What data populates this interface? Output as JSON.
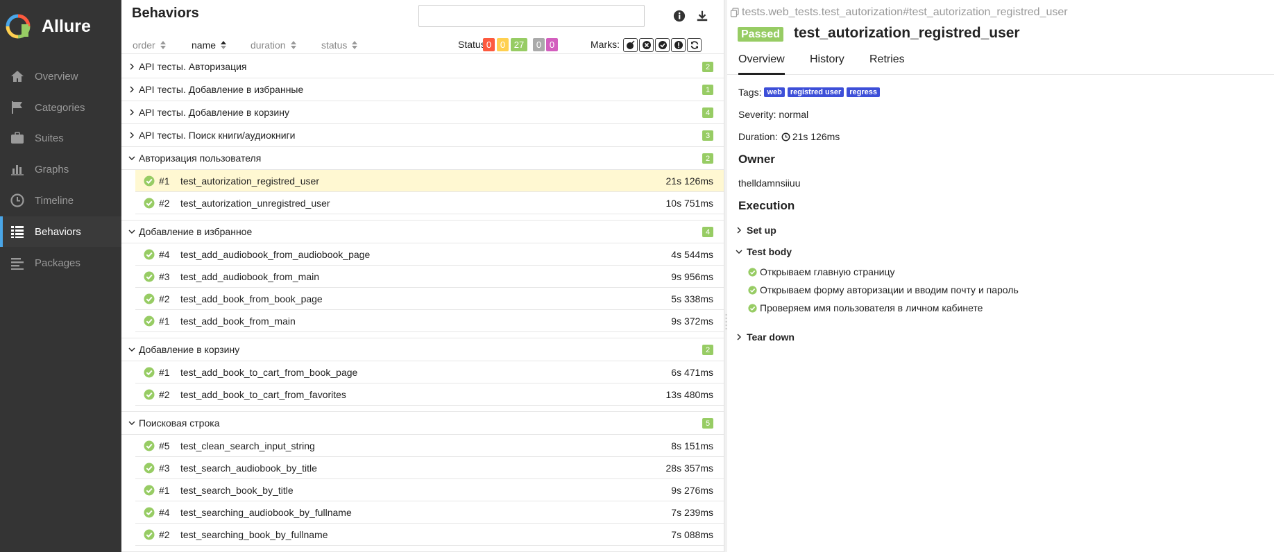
{
  "sidebar": {
    "brand": "Allure",
    "items": [
      {
        "label": "Overview",
        "icon": "home-icon"
      },
      {
        "label": "Categories",
        "icon": "flag-icon"
      },
      {
        "label": "Suites",
        "icon": "briefcase-icon"
      },
      {
        "label": "Graphs",
        "icon": "bar-chart-icon"
      },
      {
        "label": "Timeline",
        "icon": "clock-icon"
      },
      {
        "label": "Behaviors",
        "icon": "list-icon",
        "active": true
      },
      {
        "label": "Packages",
        "icon": "align-left-icon"
      }
    ]
  },
  "tree": {
    "title": "Behaviors",
    "search": {
      "value": "",
      "placeholder": ""
    },
    "sort": {
      "order": "order",
      "name": "name",
      "duration": "duration",
      "status": "status",
      "active": "name"
    },
    "status_label": "Status:",
    "status_counts": [
      {
        "value": "0",
        "color": "#fd5a3e"
      },
      {
        "value": "0",
        "color": "#ffd050"
      },
      {
        "value": "27",
        "color": "#97cc64"
      },
      {
        "value": "0",
        "color": "#aaaaaa"
      },
      {
        "value": "0",
        "color": "#d35ebe"
      }
    ],
    "marks_label": "Marks:",
    "colors": {
      "passed": "#97cc64",
      "selected_bg": "#fff8d2",
      "accent": "#4aa6e8"
    },
    "groups": [
      {
        "name": "API тесты. Авторизация",
        "count": "2",
        "expanded": false,
        "tests": []
      },
      {
        "name": "API тесты. Добавление в избранные",
        "count": "1",
        "expanded": false,
        "tests": []
      },
      {
        "name": "API тесты. Добавление в корзину",
        "count": "4",
        "expanded": false,
        "tests": []
      },
      {
        "name": "API тесты. Поиск книги/аудиокниги",
        "count": "3",
        "expanded": false,
        "tests": []
      },
      {
        "name": "Авторизация пользователя",
        "count": "2",
        "expanded": true,
        "tests": [
          {
            "num": "#1",
            "name": "test_autorization_registred_user",
            "duration": "21s 126ms",
            "selected": true
          },
          {
            "num": "#2",
            "name": "test_autorization_unregistred_user",
            "duration": "10s 751ms"
          }
        ]
      },
      {
        "name": "Добавление в избранное",
        "count": "4",
        "expanded": true,
        "tests": [
          {
            "num": "#4",
            "name": "test_add_audiobook_from_audiobook_page",
            "duration": "4s 544ms"
          },
          {
            "num": "#3",
            "name": "test_add_audiobook_from_main",
            "duration": "9s 956ms"
          },
          {
            "num": "#2",
            "name": "test_add_book_from_book_page",
            "duration": "5s 338ms"
          },
          {
            "num": "#1",
            "name": "test_add_book_from_main",
            "duration": "9s 372ms"
          }
        ]
      },
      {
        "name": "Добавление в корзину",
        "count": "2",
        "expanded": true,
        "tests": [
          {
            "num": "#1",
            "name": "test_add_book_to_cart_from_book_page",
            "duration": "6s 471ms"
          },
          {
            "num": "#2",
            "name": "test_add_book_to_cart_from_favorites",
            "duration": "13s 480ms"
          }
        ]
      },
      {
        "name": "Поисковая строка",
        "count": "5",
        "expanded": true,
        "tests": [
          {
            "num": "#5",
            "name": "test_clean_search_input_string",
            "duration": "8s 151ms"
          },
          {
            "num": "#3",
            "name": "test_search_audiobook_by_title",
            "duration": "28s 357ms"
          },
          {
            "num": "#1",
            "name": "test_search_book_by_title",
            "duration": "9s 276ms"
          },
          {
            "num": "#4",
            "name": "test_searching_audiobook_by_fullname",
            "duration": "7s 239ms"
          },
          {
            "num": "#2",
            "name": "test_searching_book_by_fullname",
            "duration": "7s 088ms"
          }
        ]
      }
    ]
  },
  "detail": {
    "path": "tests.web_tests.test_autorization#test_autorization_registred_user",
    "status": "Passed",
    "title": "test_autorization_registred_user",
    "tabs": [
      "Overview",
      "History",
      "Retries"
    ],
    "tags_label": "Tags:",
    "tags": [
      "web",
      "registred user",
      "regress"
    ],
    "severity": "Severity: normal",
    "duration_label": "Duration:",
    "duration": "21s 126ms",
    "owner_title": "Owner",
    "owner": "thelldamnsiiuu",
    "execution_title": "Execution",
    "setup": "Set up",
    "test_body": "Test body",
    "steps": [
      "Открываем главную страницу",
      "Открываем форму авторизации и вводим почту и пароль",
      "Проверяем имя пользователя в личном кабинете"
    ],
    "teardown": "Tear down"
  }
}
